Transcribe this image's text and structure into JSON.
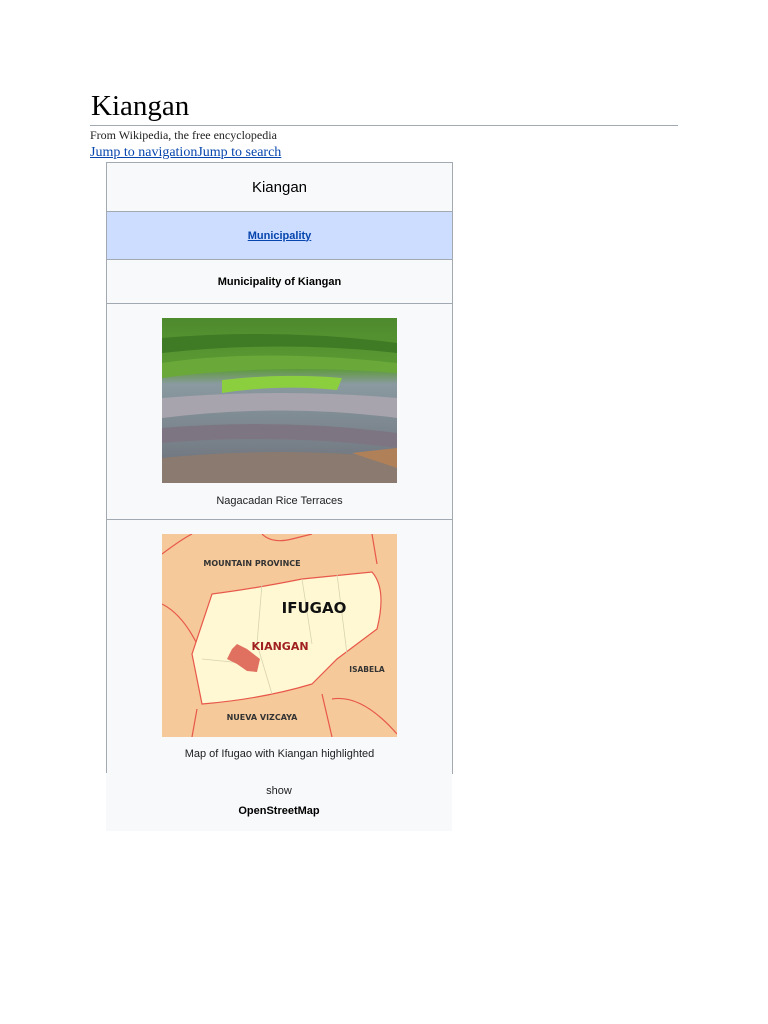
{
  "page": {
    "title": "Kiangan",
    "tagline": "From Wikipedia, the free encyclopedia",
    "jump_nav": "Jump to navigation",
    "jump_search": "Jump to search"
  },
  "infobox": {
    "title": "Kiangan",
    "type_link": "Municipality",
    "official_name": "Municipality of Kiangan",
    "photo_caption": "Nagacadan Rice Terraces",
    "map_caption": "Map of Ifugao with Kiangan highlighted",
    "map_labels": {
      "north": "MOUNTAIN PROVINCE",
      "province": "IFUGAO",
      "town": "KIANGAN",
      "east": "ISABELA",
      "south": "NUEVA VIZCAYA"
    },
    "show_toggle": "show",
    "osm_label": "OpenStreetMap"
  },
  "colors": {
    "link": "#0645ad",
    "header_bg": "#ccddff",
    "box_bg": "#f8f9fa"
  }
}
